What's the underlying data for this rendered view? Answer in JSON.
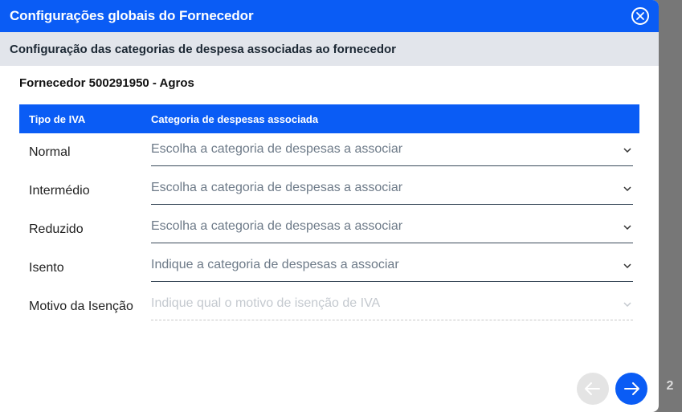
{
  "modal": {
    "title": "Configurações globais do Fornecedor",
    "subtitle": "Configuração das categorias de despesa associadas ao fornecedor",
    "supplier": "Fornecedor 500291950 - Agros"
  },
  "table": {
    "col_vat_type": "Tipo de IVA",
    "col_category": "Categoria de despesas associada",
    "rows": [
      {
        "label": "Normal",
        "placeholder": "Escolha a categoria de despesas a associar",
        "disabled": false
      },
      {
        "label": "Intermédio",
        "placeholder": "Escolha a categoria de despesas a associar",
        "disabled": false
      },
      {
        "label": "Reduzido",
        "placeholder": "Escolha a categoria de despesas a associar",
        "disabled": false
      },
      {
        "label": "Isento",
        "placeholder": "Indique a categoria de despesas a associar",
        "disabled": false
      },
      {
        "label": "Motivo da Isenção",
        "placeholder": "Indique qual o motivo de isenção de IVA",
        "disabled": true
      }
    ]
  },
  "pagination": {
    "page": "2"
  },
  "icons": {
    "close": "close-circle-icon",
    "chevron": "chevron-down-icon",
    "prev": "arrow-left-icon",
    "next": "arrow-right-icon"
  },
  "colors": {
    "primary": "#0a5cf5",
    "subheader_bg": "#e2e5eb",
    "disabled_nav": "#e4e4e4"
  }
}
